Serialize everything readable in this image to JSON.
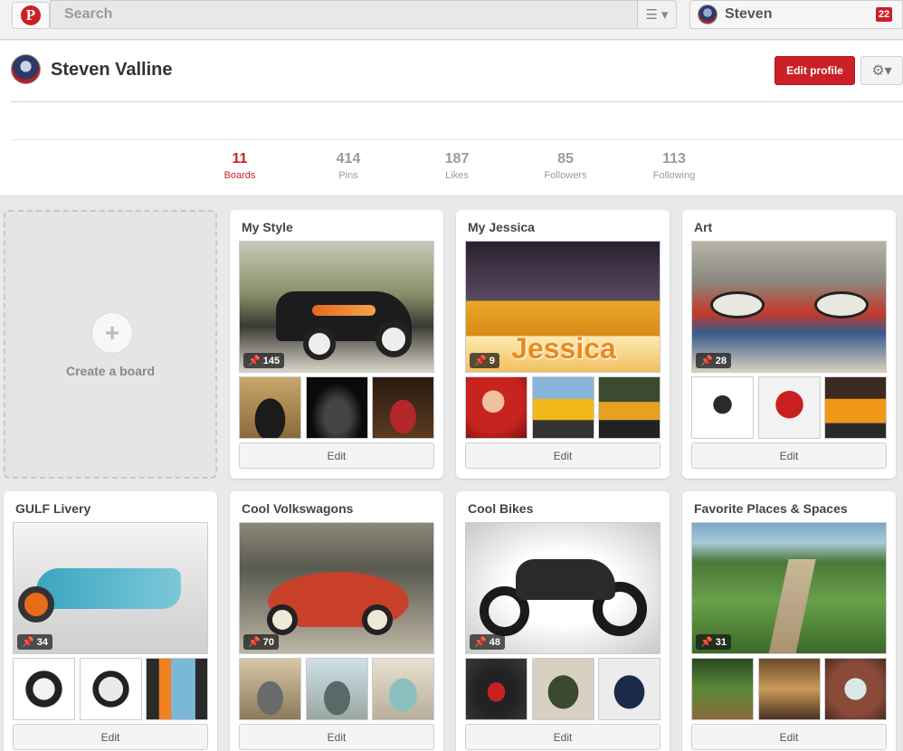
{
  "topbar": {
    "logo": "pinterest-logo",
    "search_placeholder": "Search",
    "menu_icon": "hamburger-icon",
    "user_name": "Steven",
    "notification_count": "22"
  },
  "profile": {
    "name": "Steven Valline",
    "edit_profile_label": "Edit profile",
    "stats": [
      {
        "value": "11",
        "label": "Boards",
        "active": true
      },
      {
        "value": "414",
        "label": "Pins",
        "active": false
      },
      {
        "value": "187",
        "label": "Likes",
        "active": false
      },
      {
        "value": "85",
        "label": "Followers",
        "active": false
      },
      {
        "value": "113",
        "label": "Following",
        "active": false
      }
    ]
  },
  "create_board": {
    "label": "Create a board"
  },
  "boards": [
    {
      "title": "My Style",
      "pin_count": "145"
    },
    {
      "title": "My Jessica",
      "pin_count": "9"
    },
    {
      "title": "Art",
      "pin_count": "28"
    },
    {
      "title": "GULF Livery",
      "pin_count": "34"
    },
    {
      "title": "Cool Volkswagons",
      "pin_count": "70"
    },
    {
      "title": "Cool Bikes",
      "pin_count": "48"
    },
    {
      "title": "Favorite Places & Spaces",
      "pin_count": "31"
    }
  ],
  "edit_label": "Edit",
  "colors": {
    "brand_red": "#cb2027",
    "background": "#e9e9e9"
  }
}
